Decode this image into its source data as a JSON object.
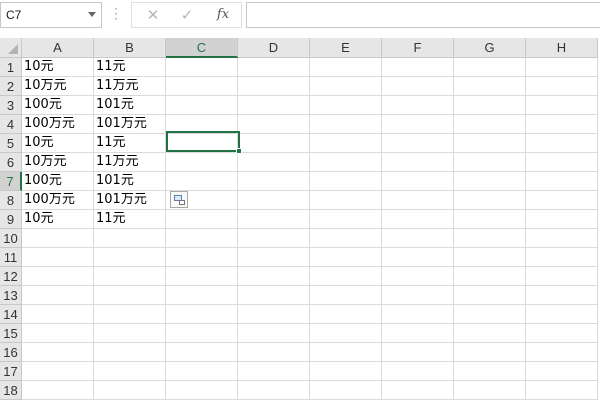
{
  "formula_bar": {
    "name_box": "C7",
    "cancel_glyph": "✕",
    "enter_glyph": "✓",
    "fx_label": "fx",
    "formula_value": ""
  },
  "columns": [
    "A",
    "B",
    "C",
    "D",
    "E",
    "F",
    "G",
    "H"
  ],
  "selected_column": "C",
  "selected_row": 7,
  "rows": [
    {
      "num": "1",
      "cells": [
        "10元",
        "11元",
        "",
        "",
        "",
        "",
        "",
        ""
      ]
    },
    {
      "num": "2",
      "cells": [
        "10万元",
        "11万元",
        "",
        "",
        "",
        "",
        "",
        ""
      ]
    },
    {
      "num": "3",
      "cells": [
        "100元",
        "101元",
        "",
        "",
        "",
        "",
        "",
        ""
      ]
    },
    {
      "num": "4",
      "cells": [
        "100万元",
        "101万元",
        "",
        "",
        "",
        "",
        "",
        ""
      ]
    },
    {
      "num": "5",
      "cells": [
        "10元",
        "11元",
        "",
        "",
        "",
        "",
        "",
        ""
      ]
    },
    {
      "num": "6",
      "cells": [
        "10万元",
        "11万元",
        "",
        "",
        "",
        "",
        "",
        ""
      ]
    },
    {
      "num": "7",
      "cells": [
        "100元",
        "101元",
        "",
        "",
        "",
        "",
        "",
        ""
      ]
    },
    {
      "num": "8",
      "cells": [
        "100万元",
        "101万元",
        "",
        "",
        "",
        "",
        "",
        ""
      ]
    },
    {
      "num": "9",
      "cells": [
        "10元",
        "11元",
        "",
        "",
        "",
        "",
        "",
        ""
      ]
    },
    {
      "num": "10",
      "cells": [
        "",
        "",
        "",
        "",
        "",
        "",
        "",
        ""
      ]
    },
    {
      "num": "11",
      "cells": [
        "",
        "",
        "",
        "",
        "",
        "",
        "",
        ""
      ]
    },
    {
      "num": "12",
      "cells": [
        "",
        "",
        "",
        "",
        "",
        "",
        "",
        ""
      ]
    },
    {
      "num": "13",
      "cells": [
        "",
        "",
        "",
        "",
        "",
        "",
        "",
        ""
      ]
    },
    {
      "num": "14",
      "cells": [
        "",
        "",
        "",
        "",
        "",
        "",
        "",
        ""
      ]
    },
    {
      "num": "15",
      "cells": [
        "",
        "",
        "",
        "",
        "",
        "",
        "",
        ""
      ]
    },
    {
      "num": "16",
      "cells": [
        "",
        "",
        "",
        "",
        "",
        "",
        "",
        ""
      ]
    },
    {
      "num": "17",
      "cells": [
        "",
        "",
        "",
        "",
        "",
        "",
        "",
        ""
      ]
    },
    {
      "num": "18",
      "cells": [
        "",
        "",
        "",
        "",
        "",
        "",
        "",
        ""
      ]
    }
  ],
  "icons": {
    "name_box_dropdown": "chevron-down-icon",
    "paste_options": "paste-options-icon",
    "select_all": "select-all-triangle-icon"
  }
}
